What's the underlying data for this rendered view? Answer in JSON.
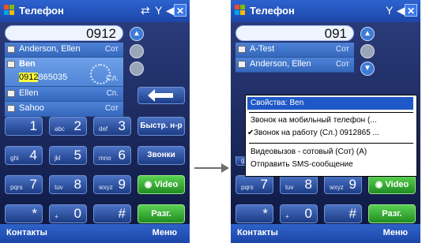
{
  "app": {
    "title": "Телефон"
  },
  "left_screen": {
    "number": "0912",
    "contacts": [
      {
        "name": "Anderson, Ellen",
        "type": "Сот"
      },
      {
        "name": "Ben",
        "number_match": "0912",
        "number_rest": "865035",
        "type": "Сл."
      },
      {
        "name": "Ellen",
        "type": "Сп."
      },
      {
        "name": "Sahoo",
        "type": "Сот"
      }
    ]
  },
  "right_screen": {
    "number": "091",
    "contacts": [
      {
        "name": "A-Test",
        "type": "Сот"
      },
      {
        "name": "Anderson, Ellen",
        "type": "Сот"
      }
    ]
  },
  "keypad": {
    "keys": [
      {
        "digit": "1",
        "letters": ""
      },
      {
        "digit": "2",
        "letters": "abc"
      },
      {
        "digit": "3",
        "letters": "def"
      },
      {
        "digit": "4",
        "letters": "ghi"
      },
      {
        "digit": "5",
        "letters": "jkl"
      },
      {
        "digit": "6",
        "letters": "mno"
      },
      {
        "digit": "7",
        "letters": "pqrs"
      },
      {
        "digit": "8",
        "letters": "tuv"
      },
      {
        "digit": "9",
        "letters": "wxyz"
      },
      {
        "digit": "*",
        "letters": ""
      },
      {
        "digit": "0",
        "letters": "+"
      },
      {
        "digit": "#",
        "letters": ""
      }
    ],
    "speed_dial_label": "Быстр. н-р",
    "calls_label": "Звонки",
    "video_label": "Video",
    "talk_label": "Разг."
  },
  "softkeys": {
    "left": "Контакты",
    "right": "Меню"
  },
  "context_menu": {
    "header": "Свойства: Ben",
    "items": [
      "Звонок на мобильный телефон (...",
      "Звонок на работу (Сл.) 0912865 ...",
      "Видеовызов - сотовый (Сот) (А)",
      "Отправить SMS-сообщение"
    ]
  },
  "colors": {
    "title_bar": "#2d63cf",
    "menu_highlight": "#1f58c7",
    "talk_button": "#3bb23a",
    "match_highlight": "#ffff40"
  }
}
